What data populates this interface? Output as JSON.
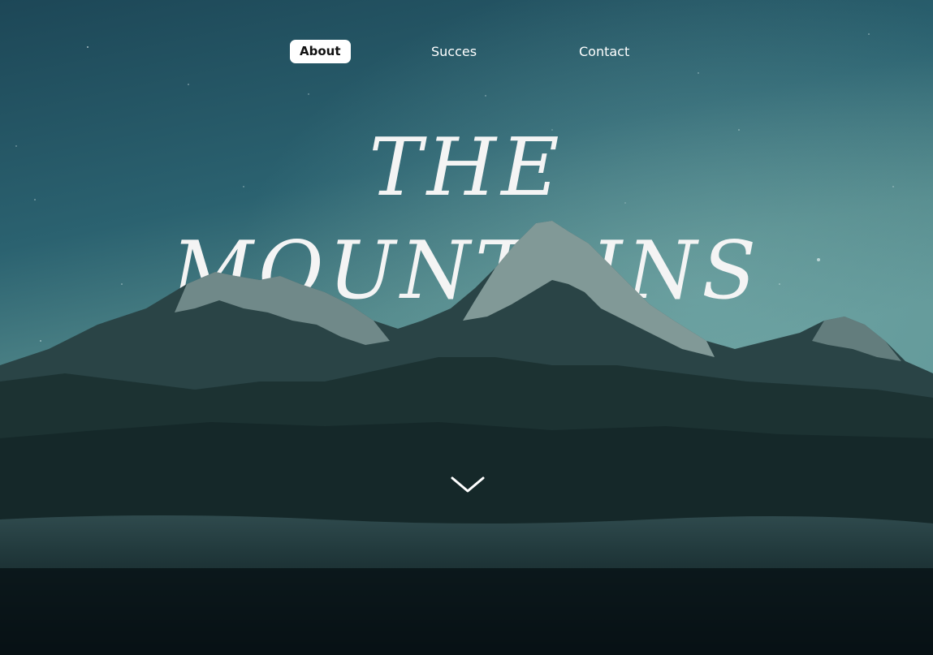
{
  "nav": {
    "items": [
      {
        "label": "About",
        "active": true
      },
      {
        "label": "Succes",
        "active": false
      },
      {
        "label": "Contact",
        "active": false
      }
    ]
  },
  "hero": {
    "title_line_1": "THE",
    "title_line_2": "MOUNTAINS"
  },
  "icons": {
    "scroll": "chevron-down-icon"
  },
  "colors": {
    "sky_top": "#1f4b5b",
    "sky_bottom": "#5a8f92",
    "mountain_dark": "#16292b",
    "snow": "#c9d6d4",
    "fog": "#2c4448",
    "text": "#f4f4f4"
  }
}
